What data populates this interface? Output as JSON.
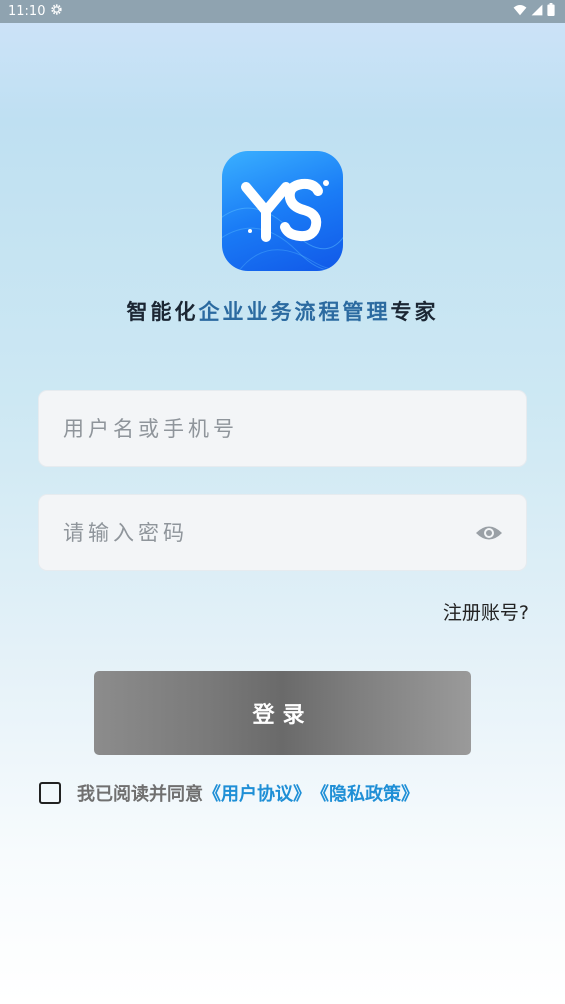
{
  "status_bar": {
    "time": "11:10",
    "icons": [
      "settings-gear-icon",
      "wifi-icon",
      "signal-icon",
      "battery-icon"
    ]
  },
  "logo": {
    "text": "YS",
    "icon": "ys-app-logo",
    "colors": {
      "top": "#3ab0ff",
      "bottom": "#1158e8"
    }
  },
  "tagline": {
    "part1": "智能化",
    "part2": "企业业务流程管理",
    "part3": "专家"
  },
  "login_form": {
    "username": {
      "value": "",
      "placeholder": "用户名或手机号"
    },
    "password": {
      "value": "",
      "placeholder": "请输入密码",
      "toggle_icon": "eye-icon"
    },
    "register_label": "注册账号?",
    "submit_label": "登录"
  },
  "agreement": {
    "checked": false,
    "prefix": "我已阅读并同意",
    "user_agreement": "《用户协议》",
    "privacy_policy": "《隐私政策》"
  },
  "colors": {
    "link": "#1f8fd6",
    "button": "#7a7a7a",
    "field_bg": "#f3f5f7"
  }
}
